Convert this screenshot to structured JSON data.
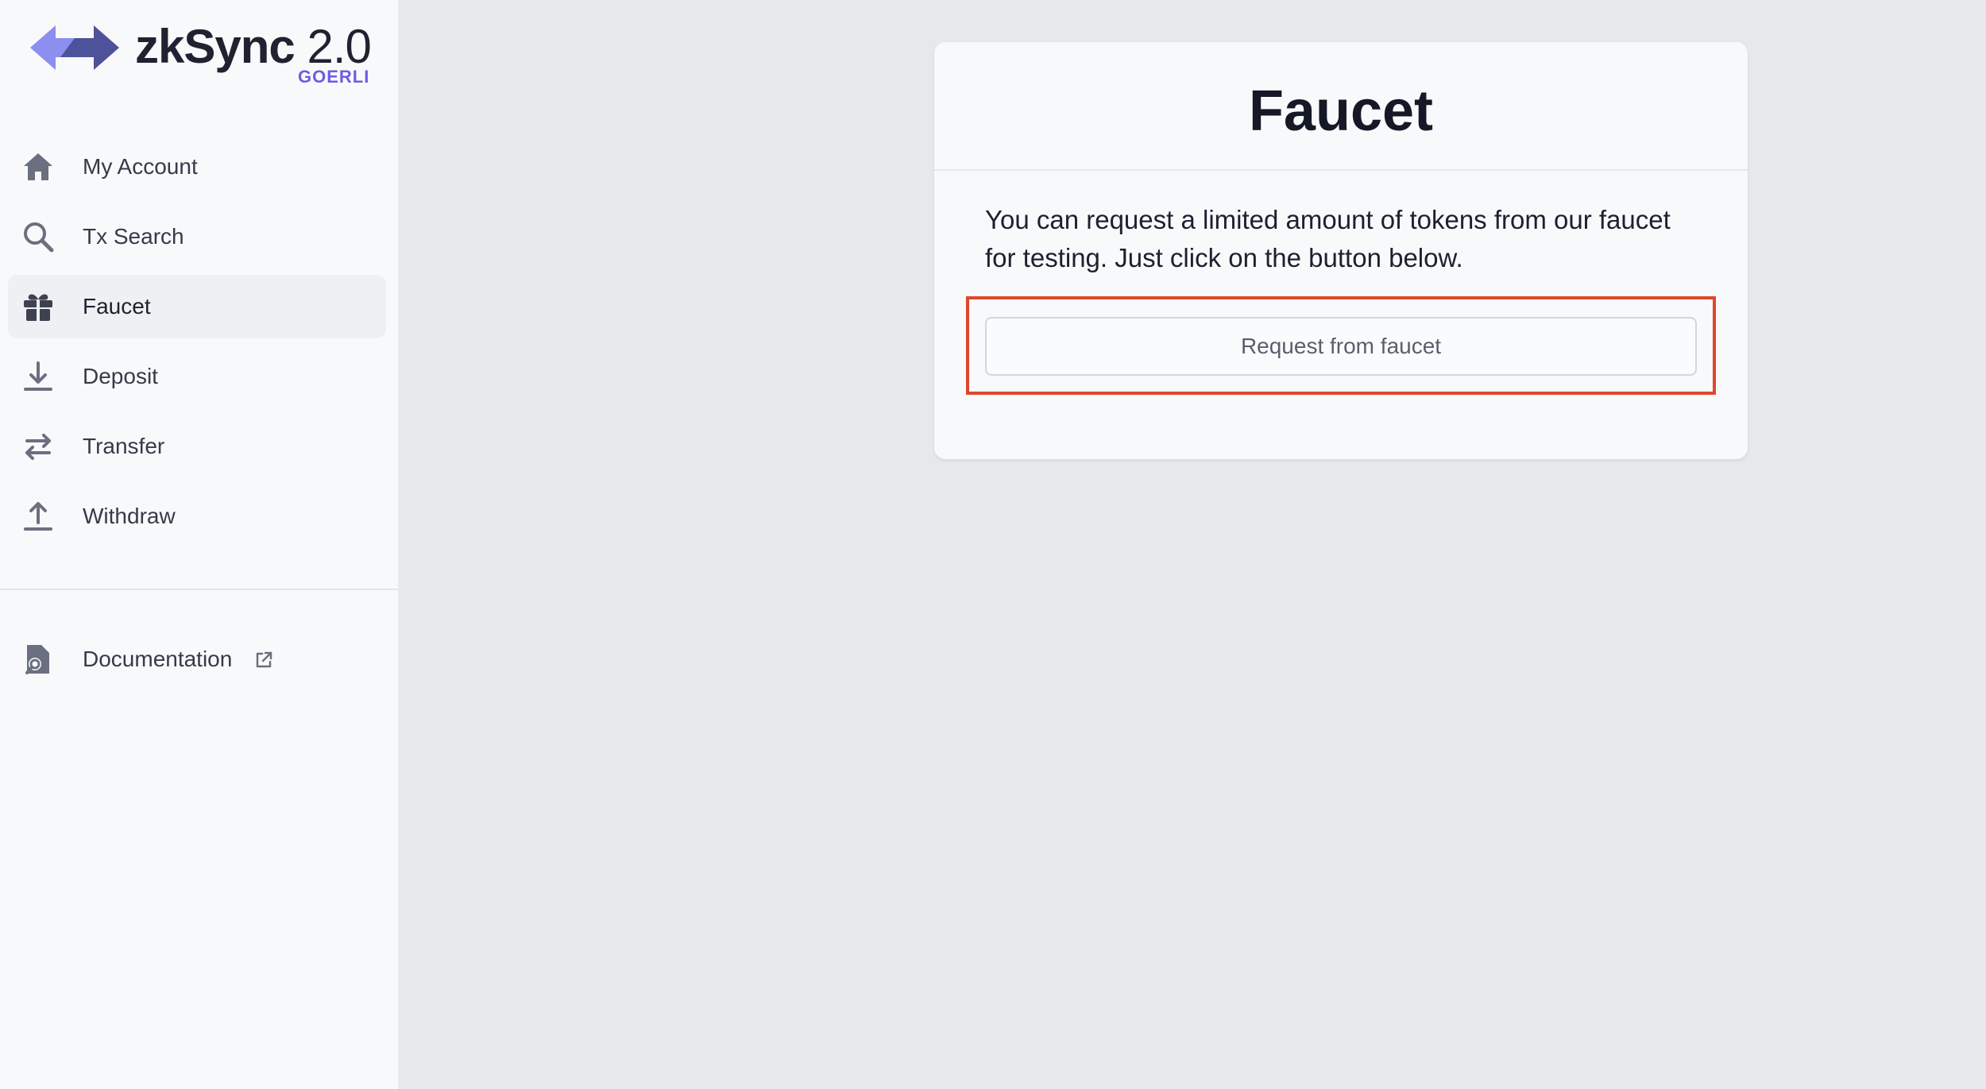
{
  "logo": {
    "brand": "zkSync",
    "version": "2.0",
    "network": "GOERLI"
  },
  "sidebar": {
    "items": [
      {
        "label": "My Account",
        "icon": "home-icon"
      },
      {
        "label": "Tx Search",
        "icon": "search-icon"
      },
      {
        "label": "Faucet",
        "icon": "gift-icon",
        "active": true
      },
      {
        "label": "Deposit",
        "icon": "download-icon"
      },
      {
        "label": "Transfer",
        "icon": "transfer-icon"
      },
      {
        "label": "Withdraw",
        "icon": "upload-icon"
      }
    ],
    "documentation": {
      "label": "Documentation",
      "icon": "documentation-icon",
      "external_icon": "external-link-icon"
    }
  },
  "card": {
    "title": "Faucet",
    "description": "You can request a limited amount of tokens from our faucet for testing. Just click on the button below.",
    "button_label": "Request from faucet"
  },
  "colors": {
    "accent": "#6d5de0",
    "highlight": "#e0462c",
    "icon": "#6b7080"
  }
}
